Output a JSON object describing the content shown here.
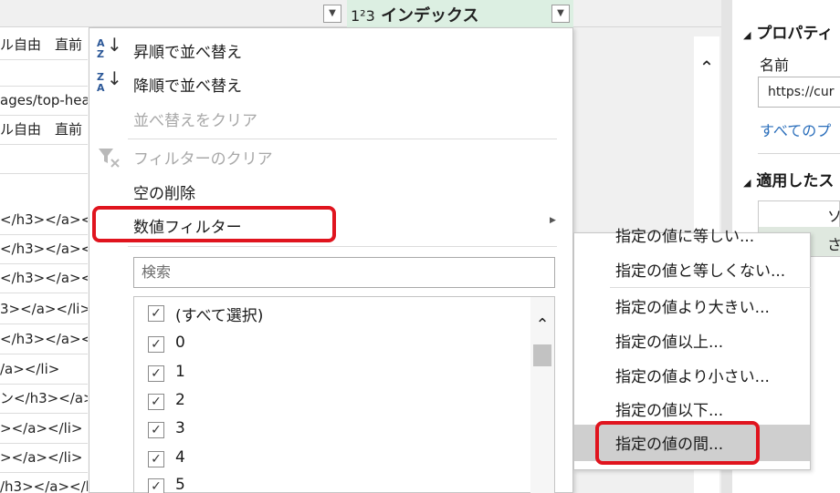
{
  "grid": {
    "index_column": {
      "type_icon": "1²3",
      "label": "インデックス"
    },
    "left_rows": [
      "ル自由　直前",
      "",
      "ages/top-hea",
      "ル自由　直前",
      "",
      "</h3></a></li",
      "</h3></a></li",
      "</h3></a></li",
      "3></a></li>",
      "</h3></a></",
      "/a></li>",
      "ン</h3></a><",
      "></a></li>",
      "></a></li>",
      "/h3></a></li"
    ]
  },
  "menu": {
    "sort_asc_icon": {
      "top": "A",
      "bottom": "Z"
    },
    "sort_desc_icon": {
      "top": "Z",
      "bottom": "A"
    },
    "items": {
      "sort_asc": "昇順で並べ替え",
      "sort_desc": "降順で並べ替え",
      "clear_sort": "並べ替えをクリア",
      "clear_filter": "フィルターのクリア",
      "remove_empty": "空の削除",
      "number_filters": "数値フィルター"
    },
    "search_placeholder": "検索",
    "values": [
      "(すべて選択)",
      "0",
      "1",
      "2",
      "3",
      "4",
      "5"
    ],
    "check_mark": "☑"
  },
  "submenu": {
    "items": [
      "指定の値に等しい...",
      "指定の値と等しくない...",
      "指定の値より大きい...",
      "指定の値以上...",
      "指定の値より小さい...",
      "指定の値以下...",
      "指定の値の間..."
    ]
  },
  "properties_pane": {
    "section_title": "プロパティ",
    "name_label": "名前",
    "name_value": "https://cur",
    "all_properties_link": "すべてのプ",
    "applied_steps_title": "適用したス",
    "step_1_partial": "ソース",
    "step_2_partial": "さ"
  },
  "colors": {
    "highlight_red": "#e0141e",
    "header_green": "#21a47a",
    "link_blue": "#2a6ebb"
  }
}
